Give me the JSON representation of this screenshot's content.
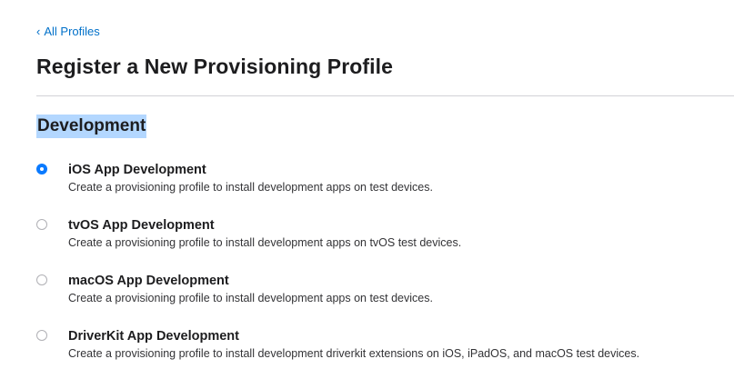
{
  "nav": {
    "back_chevron": "‹",
    "back_label": "All Profiles"
  },
  "page": {
    "title": "Register a New Provisioning Profile"
  },
  "section": {
    "heading": "Development",
    "options": [
      {
        "title": "iOS App Development",
        "description": "Create a provisioning profile to install development apps on test devices.",
        "selected": true
      },
      {
        "title": "tvOS App Development",
        "description": "Create a provisioning profile to install development apps on tvOS test devices.",
        "selected": false
      },
      {
        "title": "macOS App Development",
        "description": "Create a provisioning profile to install development apps on test devices.",
        "selected": false
      },
      {
        "title": "DriverKit App Development",
        "description": "Create a provisioning profile to install development driverkit extensions on iOS, iPadOS, and macOS test devices.",
        "selected": false
      }
    ]
  },
  "colors": {
    "link": "#0070c9",
    "radio_selected": "#0a7aff",
    "text_selection_highlight": "#b3d7ff",
    "divider": "#d2d2d7"
  }
}
